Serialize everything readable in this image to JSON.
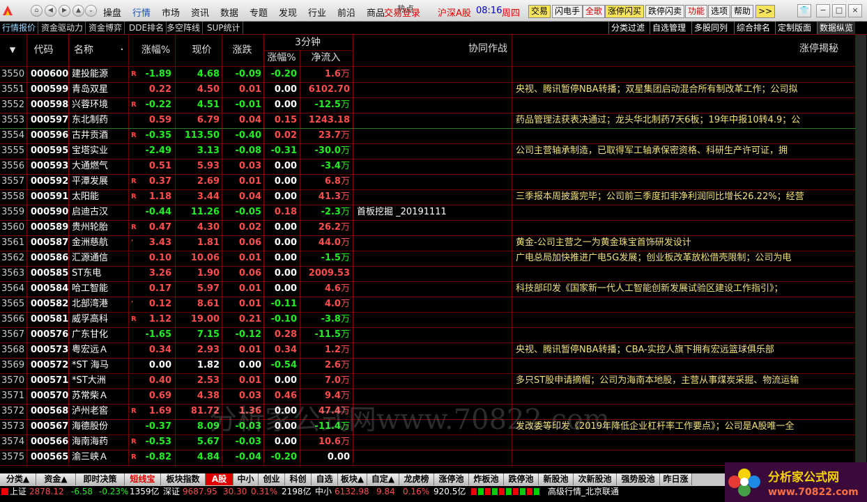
{
  "top": {
    "menus": [
      "操盘",
      "行情",
      "市场",
      "资讯",
      "数据",
      "专题",
      "发现",
      "行业",
      "前沿",
      "商品"
    ],
    "active_menu": "行情",
    "trade_login": "交易登录",
    "hot": "热点",
    "market": "沪深A股",
    "time": "08:16",
    "weekday": "周四",
    "buttons": [
      "交易",
      "闪电手",
      "全歌",
      "涨停闪买",
      "跌停闪卖",
      "功能",
      "选项",
      "帮助",
      ">>"
    ]
  },
  "subtabs": {
    "left": [
      "行情报价",
      "资金驱动力",
      "资金博弈",
      "DDE排名",
      "多空阵线",
      "SUP统计"
    ],
    "right": [
      "分类过滤",
      "自选管理",
      "多股同列",
      "综合排名",
      "定制版面",
      "数据纵览"
    ]
  },
  "headers": {
    "code": "代码",
    "name": "名称",
    "chg": "涨幅%",
    "price": "现价",
    "zd": "涨跌",
    "m3": "3分钟",
    "m3_chg": "涨幅%",
    "m3_net": "净流入",
    "sync": "协同作战",
    "reveal": "涨停揭秘"
  },
  "rows": [
    {
      "idx": "3550",
      "code": "000600",
      "name": "建投能源",
      "flag": "R",
      "chg": "-1.89",
      "price": "4.68",
      "zd": "-0.09",
      "m3": "-0.20",
      "net": "1.6",
      "net_unit": "万",
      "sync": "",
      "reveal": ""
    },
    {
      "idx": "3551",
      "code": "000599",
      "name": "青岛双星",
      "flag": "",
      "chg": "0.22",
      "price": "4.50",
      "zd": "0.01",
      "m3": "0.00",
      "net": "6102.70",
      "net_unit": "",
      "sync": "",
      "reveal": "央视、腾讯暂停NBA转播；双星集团启动混合所有制改革工作；公司拟"
    },
    {
      "idx": "3552",
      "code": "000598",
      "name": "兴蓉环境",
      "flag": "R",
      "chg": "-0.22",
      "price": "4.51",
      "zd": "-0.01",
      "m3": "0.00",
      "net": "-12.5",
      "net_unit": "万",
      "sync": "",
      "reveal": ""
    },
    {
      "idx": "3553",
      "code": "000597",
      "name": "东北制药",
      "flag": "",
      "chg": "0.59",
      "price": "6.79",
      "zd": "0.04",
      "m3": "0.15",
      "net": "1243.18",
      "net_unit": "",
      "sync": "",
      "reveal": "药品管理法获表决通过；龙头华北制药7天6板；19年中报10转4.9；公"
    },
    {
      "idx": "3554",
      "code": "000596",
      "name": "古井贡酒",
      "flag": "R",
      "chg": "-0.35",
      "price": "113.50",
      "zd": "-0.40",
      "m3": "0.02",
      "net": "23.7",
      "net_unit": "万",
      "sync": "",
      "reveal": ""
    },
    {
      "idx": "3555",
      "code": "000595",
      "name": "宝塔实业",
      "flag": "",
      "chg": "-2.49",
      "price": "3.13",
      "zd": "-0.08",
      "m3": "-0.31",
      "net": "-30.0",
      "net_unit": "万",
      "sync": "",
      "reveal": "公司主营轴承制造，已取得军工轴承保密资格、科研生产许可证，拥"
    },
    {
      "idx": "3556",
      "code": "000593",
      "name": "大通燃气",
      "flag": "",
      "chg": "0.51",
      "price": "5.93",
      "zd": "0.03",
      "m3": "0.00",
      "net": "-3.4",
      "net_unit": "万",
      "sync": "",
      "reveal": ""
    },
    {
      "idx": "3557",
      "code": "000592",
      "name": "平潭发展",
      "flag": "R",
      "chg": "0.37",
      "price": "2.69",
      "zd": "0.01",
      "m3": "0.00",
      "net": "6.8",
      "net_unit": "万",
      "sync": "",
      "reveal": ""
    },
    {
      "idx": "3558",
      "code": "000591",
      "name": "太阳能",
      "flag": "R",
      "chg": "1.18",
      "price": "3.44",
      "zd": "0.04",
      "m3": "0.00",
      "net": "41.3",
      "net_unit": "万",
      "sync": "",
      "reveal": "三季报本周披露完毕；公司前三季度扣非净利润同比增长26.22%；经营"
    },
    {
      "idx": "3559",
      "code": "000590",
      "name": "启迪古汉",
      "flag": "",
      "chg": "-0.44",
      "price": "11.26",
      "zd": "-0.05",
      "m3": "0.18",
      "net": "-2.3",
      "net_unit": "万",
      "sync": "首板挖掘  _20191111",
      "reveal": ""
    },
    {
      "idx": "3560",
      "code": "000589",
      "name": "贵州轮胎",
      "flag": "R",
      "chg": "0.47",
      "price": "4.30",
      "zd": "0.02",
      "m3": "0.00",
      "net": "26.2",
      "net_unit": "万",
      "sync": "",
      "reveal": ""
    },
    {
      "idx": "3561",
      "code": "000587",
      "name": "金洲慈航",
      "flag": "'",
      "chg": "3.43",
      "price": "1.81",
      "zd": "0.06",
      "m3": "0.00",
      "net": "44.0",
      "net_unit": "万",
      "sync": "",
      "reveal": "黄金-公司主营之一为黄金珠宝首饰研发设计"
    },
    {
      "idx": "3562",
      "code": "000586",
      "name": "汇源通信",
      "flag": "",
      "chg": "0.10",
      "price": "10.06",
      "zd": "0.01",
      "m3": "0.00",
      "net": "-1.5",
      "net_unit": "万",
      "sync": "",
      "reveal": "广电总局加快推进广电5G发展；创业板改革放松借壳限制；公司为电"
    },
    {
      "idx": "3563",
      "code": "000585",
      "name": "ST东电",
      "flag": "",
      "chg": "3.26",
      "price": "1.90",
      "zd": "0.06",
      "m3": "0.00",
      "net": "2009.53",
      "net_unit": "",
      "sync": "",
      "reveal": ""
    },
    {
      "idx": "3564",
      "code": "000584",
      "name": "哈工智能",
      "flag": "",
      "chg": "0.17",
      "price": "5.97",
      "zd": "0.01",
      "m3": "0.00",
      "net": "4.6",
      "net_unit": "万",
      "sync": "",
      "reveal": "科技部印发《国家新一代人工智能创新发展试验区建设工作指引》；"
    },
    {
      "idx": "3565",
      "code": "000582",
      "name": "北部湾港",
      "flag": "'",
      "chg": "0.12",
      "price": "8.61",
      "zd": "0.01",
      "m3": "-0.11",
      "net": "4.0",
      "net_unit": "万",
      "sync": "",
      "reveal": ""
    },
    {
      "idx": "3566",
      "code": "000581",
      "name": "威孚高科",
      "flag": "R",
      "chg": "1.12",
      "price": "19.00",
      "zd": "0.21",
      "m3": "-0.10",
      "net": "-3.8",
      "net_unit": "万",
      "sync": "",
      "reveal": ""
    },
    {
      "idx": "3567",
      "code": "000576",
      "name": "广东甘化",
      "flag": "",
      "chg": "-1.65",
      "price": "7.15",
      "zd": "-0.12",
      "m3": "0.28",
      "net": "-11.5",
      "net_unit": "万",
      "sync": "",
      "reveal": ""
    },
    {
      "idx": "3568",
      "code": "000573",
      "name": "粤宏远Ａ",
      "flag": "",
      "chg": "0.34",
      "price": "2.93",
      "zd": "0.01",
      "m3": "0.34",
      "net": "1.2",
      "net_unit": "万",
      "sync": "",
      "reveal": "央视、腾讯暂停NBA转播；CBA-实控人旗下拥有宏远篮球俱乐部"
    },
    {
      "idx": "3569",
      "code": "000572",
      "name": "*ST 海马",
      "flag": "",
      "chg": "0.00",
      "price": "1.82",
      "zd": "0.00",
      "m3": "-0.54",
      "net": "2.6",
      "net_unit": "万",
      "sync": "",
      "reveal": ""
    },
    {
      "idx": "3570",
      "code": "000571",
      "name": "*ST大洲",
      "flag": "",
      "chg": "0.40",
      "price": "2.53",
      "zd": "0.01",
      "m3": "0.00",
      "net": "7.0",
      "net_unit": "万",
      "sync": "",
      "reveal": "多只ST股申请摘帽；公司为海南本地股，主营从事煤炭采掘、物流运输"
    },
    {
      "idx": "3571",
      "code": "000570",
      "name": "苏常柴Ａ",
      "flag": "",
      "chg": "0.69",
      "price": "4.38",
      "zd": "0.03",
      "m3": "0.46",
      "net": "9.4",
      "net_unit": "万",
      "sync": "",
      "reveal": ""
    },
    {
      "idx": "3572",
      "code": "000568",
      "name": "泸州老窖",
      "flag": "R",
      "chg": "1.69",
      "price": "81.72",
      "zd": "1.36",
      "m3": "0.00",
      "net": "47.4",
      "net_unit": "万",
      "sync": "",
      "reveal": ""
    },
    {
      "idx": "3573",
      "code": "000567",
      "name": "海德股份",
      "flag": "",
      "chg": "-0.37",
      "price": "8.09",
      "zd": "-0.03",
      "m3": "0.00",
      "net": "-11.4",
      "net_unit": "万",
      "sync": "",
      "reveal": "发改委等印发《2019年降低企业杠杆率工作要点》；公司是A股唯一全"
    },
    {
      "idx": "3574",
      "code": "000566",
      "name": "海南海药",
      "flag": "R",
      "chg": "-0.53",
      "price": "5.67",
      "zd": "-0.03",
      "m3": "0.00",
      "net": "10.6",
      "net_unit": "万",
      "sync": "",
      "reveal": ""
    },
    {
      "idx": "3575",
      "code": "000565",
      "name": "渝三峡Ａ",
      "flag": "R",
      "chg": "-0.82",
      "price": "4.84",
      "zd": "-0.04",
      "m3": "-0.20",
      "net": "0.00",
      "net_unit": "",
      "sync": "",
      "reveal": ""
    }
  ],
  "bottom_tabs": [
    "分类▲",
    "资金▲",
    "即时决策",
    "短线宝",
    "板块指数",
    "A股",
    "中小",
    "创业",
    "科创",
    "自选",
    "板块▲",
    "自定▲",
    "龙虎榜",
    "涨停池",
    "炸板池",
    "跌停池",
    "新股池",
    "次新股池",
    "强势股池",
    "昨日涨"
  ],
  "bottom_highlight": "短线宝",
  "bottom_active": "A股",
  "status": {
    "sh_label": "上证",
    "sh_val": "2878.12",
    "sh_chg": "-6.58",
    "sh_pct": "-0.23%",
    "sh_vol": "1359亿",
    "sz_label": "深证",
    "sz_val": "9687.95",
    "sz_chg": "30.30",
    "sz_pct": "0.31%",
    "sz_vol": "2198亿",
    "zx_label": "中小",
    "zx_val": "6132.98",
    "zx_chg": "9.84",
    "zx_pct": "0.16%",
    "zx_vol": "920.5亿",
    "server": "高级行情_北京联通"
  },
  "watermark": "分析家公式网www.70822.com",
  "logo_text": "分析家公式网",
  "logo_url": "www.70822.com",
  "colors": {
    "up": "#ff4d4d",
    "down": "#22ee22",
    "reveal": "#f2e07a",
    "grid": "#6a0000"
  }
}
